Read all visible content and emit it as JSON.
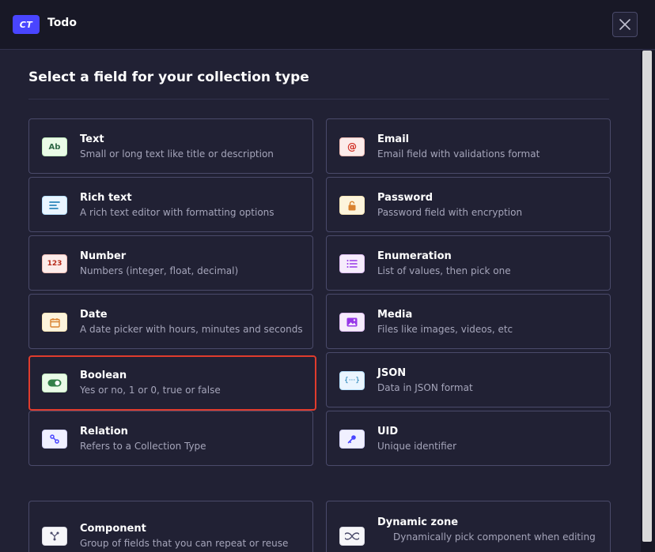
{
  "header": {
    "badge": "CT",
    "title": "Todo"
  },
  "section_title": "Select a field for your collection type",
  "fields": [
    {
      "title": "Text",
      "desc": "Small or long text like title or description",
      "icon_text": "Ab",
      "icon": "text-icon"
    },
    {
      "title": "Email",
      "desc": "Email field with validations format",
      "icon_text": "@",
      "icon": "at-icon"
    },
    {
      "title": "Rich text",
      "desc": "A rich text editor with formatting options",
      "icon": "rich-text-icon"
    },
    {
      "title": "Password",
      "desc": "Password field with encryption",
      "icon": "lock-icon"
    },
    {
      "title": "Number",
      "desc": "Numbers (integer, float, decimal)",
      "icon_text": "123",
      "icon": "number-icon"
    },
    {
      "title": "Enumeration",
      "desc": "List of values, then pick one",
      "icon": "list-icon"
    },
    {
      "title": "Date",
      "desc": "A date picker with hours, minutes and seconds",
      "icon": "calendar-icon"
    },
    {
      "title": "Media",
      "desc": "Files like images, videos, etc",
      "icon": "image-icon"
    },
    {
      "title": "Boolean",
      "desc": "Yes or no, 1 or 0, true or false",
      "icon": "toggle-icon"
    },
    {
      "title": "JSON",
      "desc": "Data in JSON format",
      "icon_text": "{···}",
      "icon": "json-icon"
    },
    {
      "title": "Relation",
      "desc": "Refers to a Collection Type",
      "icon": "link-icon"
    },
    {
      "title": "UID",
      "desc": "Unique identifier",
      "icon": "key-icon"
    },
    {
      "title": "Component",
      "desc": "Group of fields that you can repeat or reuse",
      "icon": "component-icon"
    },
    {
      "title": "Dynamic zone",
      "desc": "Dynamically pick component when editing",
      "icon": "infinity-icon"
    }
  ],
  "colors": {
    "background": "#212134",
    "header": "#181826",
    "border": "#4a4a6a",
    "selected_border": "#e03c2d",
    "accent": "#4945ff"
  }
}
